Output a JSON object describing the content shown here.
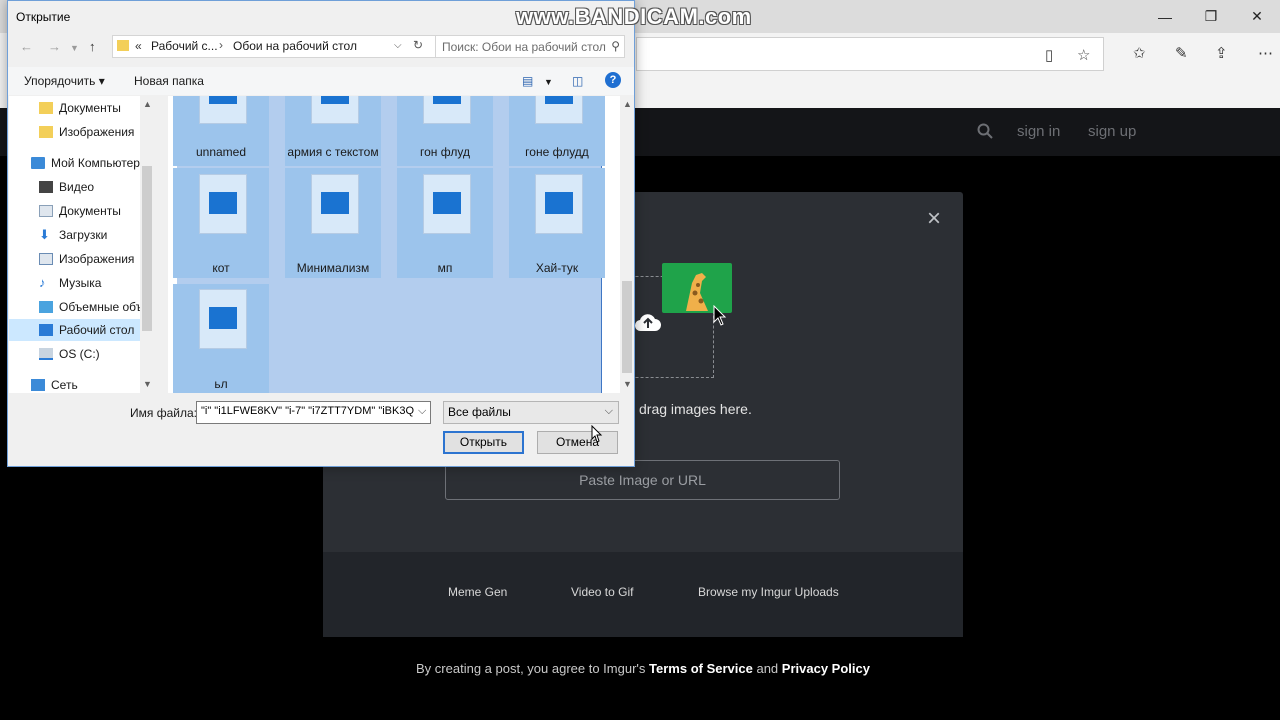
{
  "browser": {
    "window_controls": [
      "—",
      "❐",
      "✕"
    ],
    "toolbar_icons": [
      "reading-view-icon",
      "favorite-star-icon",
      "favorites-hub-icon",
      "pen-icon",
      "share-icon",
      "more-icon"
    ]
  },
  "imgur": {
    "header": {
      "sign_in": "sign in",
      "sign_up": "sign up"
    },
    "modal": {
      "close": "×",
      "drag_text": "drag images here.",
      "paste_placeholder": "Paste Image or URL"
    },
    "footer_links": [
      "Meme Gen",
      "Video to Gif",
      "Browse my Imgur Uploads"
    ],
    "terms_prefix": "By creating a post, you agree to Imgur's",
    "terms_of_service": "Terms of Service",
    "terms_and": "and",
    "privacy_policy": "Privacy Policy"
  },
  "dialog": {
    "title": "Открытие",
    "breadcrumb": {
      "root": "«",
      "part1": "Рабочий с...",
      "part2": "Обои на рабочий стол"
    },
    "search_placeholder": "Поиск: Обои на рабочий стол",
    "commands": {
      "organize": "Упорядочить ▾",
      "new_folder": "Новая папка"
    },
    "nav_items": [
      {
        "label": "Документы"
      },
      {
        "label": "Изображения"
      },
      {
        "label": "Мой Компьютер"
      },
      {
        "label": "Видео"
      },
      {
        "label": "Документы"
      },
      {
        "label": "Загрузки"
      },
      {
        "label": "Изображения"
      },
      {
        "label": "Музыка"
      },
      {
        "label": "Объемные объ"
      },
      {
        "label": "Рабочий стол"
      },
      {
        "label": "OS (C:)"
      },
      {
        "label": "Сеть"
      }
    ],
    "files": [
      "unnamed",
      "армия с текстом",
      "гон флуд",
      "гоне флудд",
      "кот",
      "Минимализм",
      "мп",
      "Хай-тук",
      "ьл"
    ],
    "filename_label": "Имя файла:",
    "filename_value": "\"i\" \"i1LFWE8KV\" \"i-7\" \"i7ZTT7YDM\" \"iBK3Q",
    "filetype": "Все файлы",
    "open_button": "Открыть",
    "cancel_button": "Отмена"
  },
  "watermark": "www.BANDICAM.com"
}
